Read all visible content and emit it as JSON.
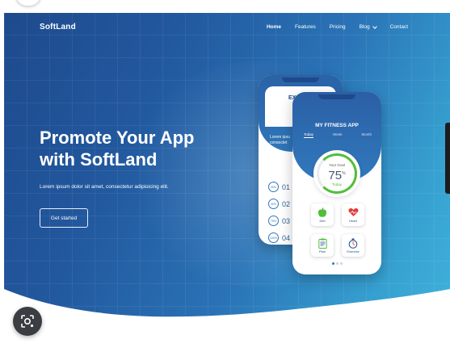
{
  "brand": "SoftLand",
  "nav": {
    "items": [
      {
        "label": "Home"
      },
      {
        "label": "Features"
      },
      {
        "label": "Pricing"
      },
      {
        "label": "Blog"
      },
      {
        "label": "Contact"
      }
    ]
  },
  "hero": {
    "headline_line1": "Promote Your App",
    "headline_line2": "with SoftLand",
    "subtitle": "Lorem ipsum dolor sit amet, consectetur adipisicing elit.",
    "cta_label": "Get started"
  },
  "phone_back": {
    "title": "EX",
    "lorem_line1": "Lorem ipsu",
    "lorem_line2": "consectet",
    "rows": [
      {
        "pct": "25%",
        "num": "01"
      },
      {
        "pct": "30%",
        "num": "02"
      },
      {
        "pct": "75%",
        "num": "03"
      },
      {
        "pct": "100%",
        "num": "04"
      }
    ]
  },
  "phone_front": {
    "title": "MY FITNESS APP",
    "tabs": [
      "Today",
      "Week",
      "Month"
    ],
    "goal_label": "Your Goal",
    "goal_value": "75",
    "goal_unit": "%",
    "goal_period": "Today",
    "tiles": [
      {
        "label": "Diet",
        "icon": "apple-icon"
      },
      {
        "label": "Heart",
        "icon": "heart-icon"
      },
      {
        "label": "Plan",
        "icon": "clipboard-icon"
      },
      {
        "label": "Exercise",
        "icon": "stopwatch-icon"
      }
    ]
  },
  "colors": {
    "hero_start": "#1e4a8d",
    "hero_end": "#3fb2da",
    "goal_ring": "#4fbf3a",
    "tile_icon_red": "#e23b3b",
    "tile_icon_green": "#4fbf3a"
  }
}
